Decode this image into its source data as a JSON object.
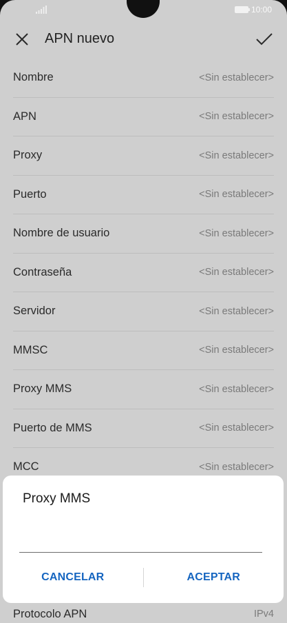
{
  "status_bar": {
    "time": "10:00"
  },
  "header": {
    "title": "APN nuevo"
  },
  "fields": [
    {
      "label": "Nombre",
      "value": "<Sin establecer>"
    },
    {
      "label": "APN",
      "value": "<Sin establecer>"
    },
    {
      "label": "Proxy",
      "value": "<Sin establecer>"
    },
    {
      "label": "Puerto",
      "value": "<Sin establecer>"
    },
    {
      "label": "Nombre de usuario",
      "value": "<Sin establecer>"
    },
    {
      "label": "Contraseña",
      "value": "<Sin establecer>"
    },
    {
      "label": "Servidor",
      "value": "<Sin establecer>"
    },
    {
      "label": "MMSC",
      "value": "<Sin establecer>"
    },
    {
      "label": "Proxy MMS",
      "value": "<Sin establecer>"
    },
    {
      "label": "Puerto de MMS",
      "value": "<Sin establecer>"
    },
    {
      "label": "MCC",
      "value": "<Sin establecer>"
    }
  ],
  "bottom_field": {
    "label": "Protocolo APN",
    "value": "IPv4"
  },
  "dialog": {
    "title": "Proxy MMS",
    "input_value": "",
    "cancel_label": "CANCELAR",
    "accept_label": "ACEPTAR"
  },
  "colors": {
    "background_dim": "#cfcfcf",
    "dialog_bg": "#ffffff",
    "accent": "#1565c0"
  }
}
